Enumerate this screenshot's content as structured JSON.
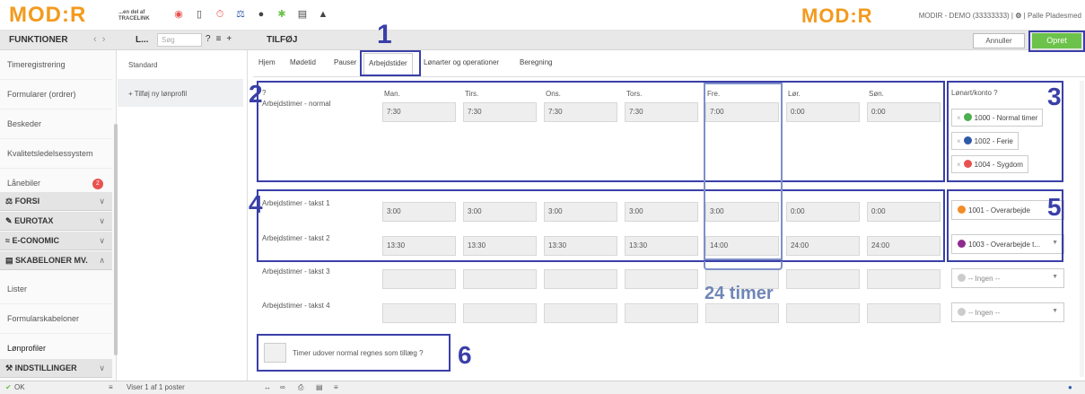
{
  "brand": {
    "logo": "MOD:R",
    "tagline": "...en del af TRACELINK"
  },
  "topbar": {
    "company": "MODIR - DEMO (33333333)",
    "user": "Palle Pladesmed",
    "icons": [
      "lifebuoy-icon",
      "phone-icon",
      "stopwatch-icon",
      "balance-icon",
      "chat-icon",
      "puzzle-icon",
      "keyboard-icon",
      "warning-icon"
    ]
  },
  "subbar": {
    "section": "FUNKTIONER",
    "list_title": "L...",
    "search_placeholder": "Søg",
    "page_title": "TILFØJ",
    "cancel": "Annuller",
    "create": "Opret"
  },
  "sidebar": {
    "items": [
      "Timeregistrering",
      "Formularer (ordrer)",
      "Beskeder",
      "Kvalitetsledelsessystem",
      "Lånebiler"
    ],
    "badge": "2",
    "groups": [
      "FORSI",
      "EUROTAX",
      "E-CONOMIC",
      "SKABELONER MV."
    ],
    "sub_items": [
      "Lister",
      "Formularskabeloner",
      "Lønprofiler"
    ],
    "settings": "INDSTILLINGER"
  },
  "list": {
    "item": "Standard",
    "add": "+ Tilføj ny lønprofil"
  },
  "tabs": [
    "Hjem",
    "Mødetid",
    "Pauser",
    "Arbejdstider",
    "Lønarter og operationer",
    "Beregning"
  ],
  "days": [
    "Man.",
    "Tirs.",
    "Ons.",
    "Tors.",
    "Fre.",
    "Lør.",
    "Søn."
  ],
  "help": "?",
  "normal": {
    "label": "Arbejdstimer - normal",
    "values": [
      "7:30",
      "7:30",
      "7:30",
      "7:30",
      "7:00",
      "0:00",
      "0:00"
    ]
  },
  "rates": [
    {
      "label": "Arbejdstimer - takst 1",
      "values": [
        "3:00",
        "3:00",
        "3:00",
        "3:00",
        "3:00",
        "0:00",
        "0:00"
      ],
      "account": "1001 - Overarbejde",
      "color": "#f28c28"
    },
    {
      "label": "Arbejdstimer - takst 2",
      "values": [
        "13:30",
        "13:30",
        "13:30",
        "13:30",
        "14:00",
        "24:00",
        "24:00"
      ],
      "account": "1003 - Overarbejde t...",
      "color": "#8e2b8e"
    },
    {
      "label": "Arbejdstimer - takst 3",
      "values": [
        "",
        "",
        "",
        "",
        "",
        "",
        ""
      ],
      "account": "-- Ingen --",
      "color": "#cccccc"
    },
    {
      "label": "Arbejdstimer - takst 4",
      "values": [
        "",
        "",
        "",
        "",
        "",
        "",
        ""
      ],
      "account": "-- Ingen --",
      "color": "#cccccc"
    }
  ],
  "accounts": {
    "header": "Lønart/konto",
    "items": [
      {
        "label": "1000 - Normal timer",
        "color": "#4caf50"
      },
      {
        "label": "1002 - Ferie",
        "color": "#2f5aa8"
      },
      {
        "label": "1004 - Sygdom",
        "color": "#e8514f"
      }
    ]
  },
  "extra": {
    "label": "Timer udover normal regnes som tillæg"
  },
  "annotations": {
    "numbers": [
      "1",
      "2",
      "3",
      "4",
      "5",
      "6"
    ],
    "timer_text": "24 timer"
  },
  "status": {
    "ok": "OK",
    "count": "Viser 1 af 1 poster"
  }
}
